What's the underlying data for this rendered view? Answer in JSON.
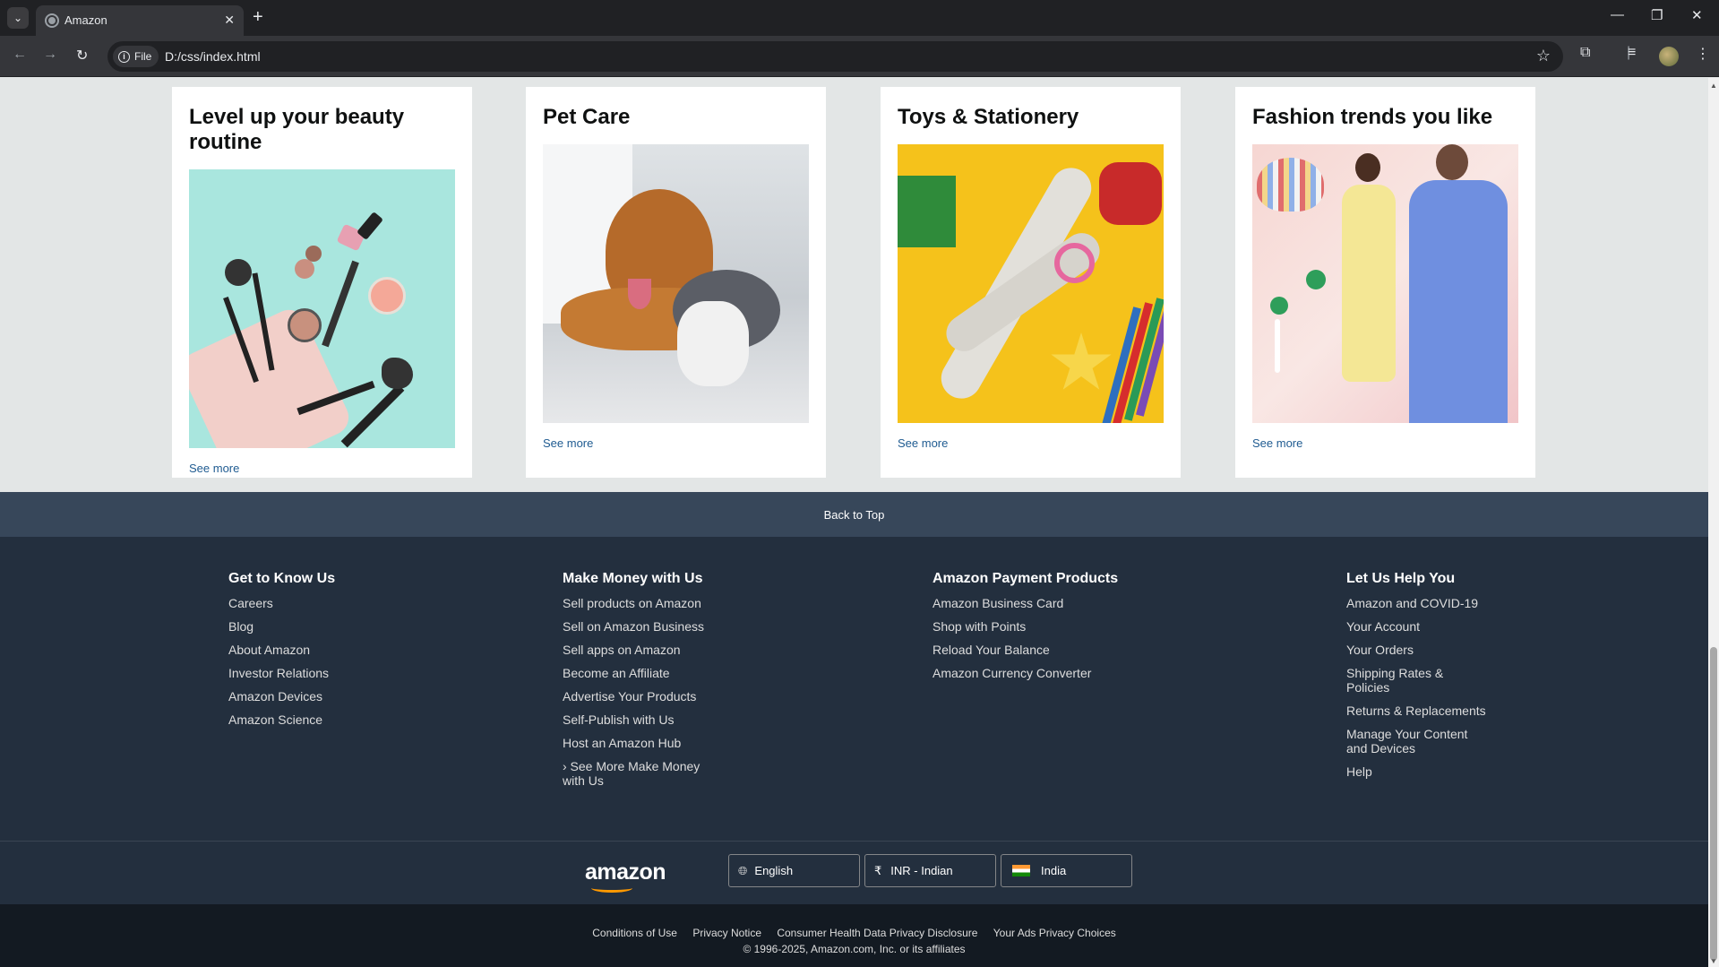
{
  "browser": {
    "tab_title": "Amazon",
    "chip_label": "File",
    "url": "D:/css/index.html"
  },
  "cards": [
    {
      "title": "Level up your beauty routine",
      "link": "See more"
    },
    {
      "title": "Pet Care",
      "link": "See more"
    },
    {
      "title": "Toys & Stationery",
      "link": "See more"
    },
    {
      "title": "Fashion trends you like",
      "link": "See more"
    }
  ],
  "back_to_top": "Back to Top",
  "footer": {
    "columns": [
      {
        "heading": "Get to Know Us",
        "links": [
          "Careers",
          "Blog",
          "About Amazon",
          "Investor Relations",
          "Amazon Devices",
          "Amazon Science"
        ]
      },
      {
        "heading": "Make Money with Us",
        "links": [
          "Sell products on Amazon",
          "Sell on Amazon Business",
          "Sell apps on Amazon",
          "Become an Affiliate",
          "Advertise Your Products",
          "Self-Publish with Us",
          "Host an Amazon Hub",
          "› See More Make Money with Us"
        ]
      },
      {
        "heading": "Amazon Payment Products",
        "links": [
          "Amazon Business Card",
          "Shop with Points",
          "Reload Your Balance",
          "Amazon Currency Converter"
        ]
      },
      {
        "heading": "Let Us Help You",
        "links": [
          "Amazon and COVID-19",
          "Your Account",
          "Your Orders",
          "Shipping Rates & Policies",
          "Returns & Replacements",
          "Manage Your Content and Devices",
          "Help"
        ]
      }
    ],
    "logo": "amazon",
    "language": "English",
    "currency_symbol": "₹",
    "currency": "INR - Indian",
    "country": "India",
    "legal_links": [
      "Conditions of Use",
      "Privacy Notice",
      "Consumer Health Data Privacy Disclosure",
      "Your Ads Privacy Choices"
    ],
    "copyright": "© 1996-2025, Amazon.com, Inc. or its affiliates"
  },
  "colors": {
    "footer_bg": "#232f3e",
    "back_to_top_bg": "#37475a",
    "footer_bottom_bg": "#131a22",
    "link": "#1f5b91",
    "accent": "#ff9900"
  }
}
